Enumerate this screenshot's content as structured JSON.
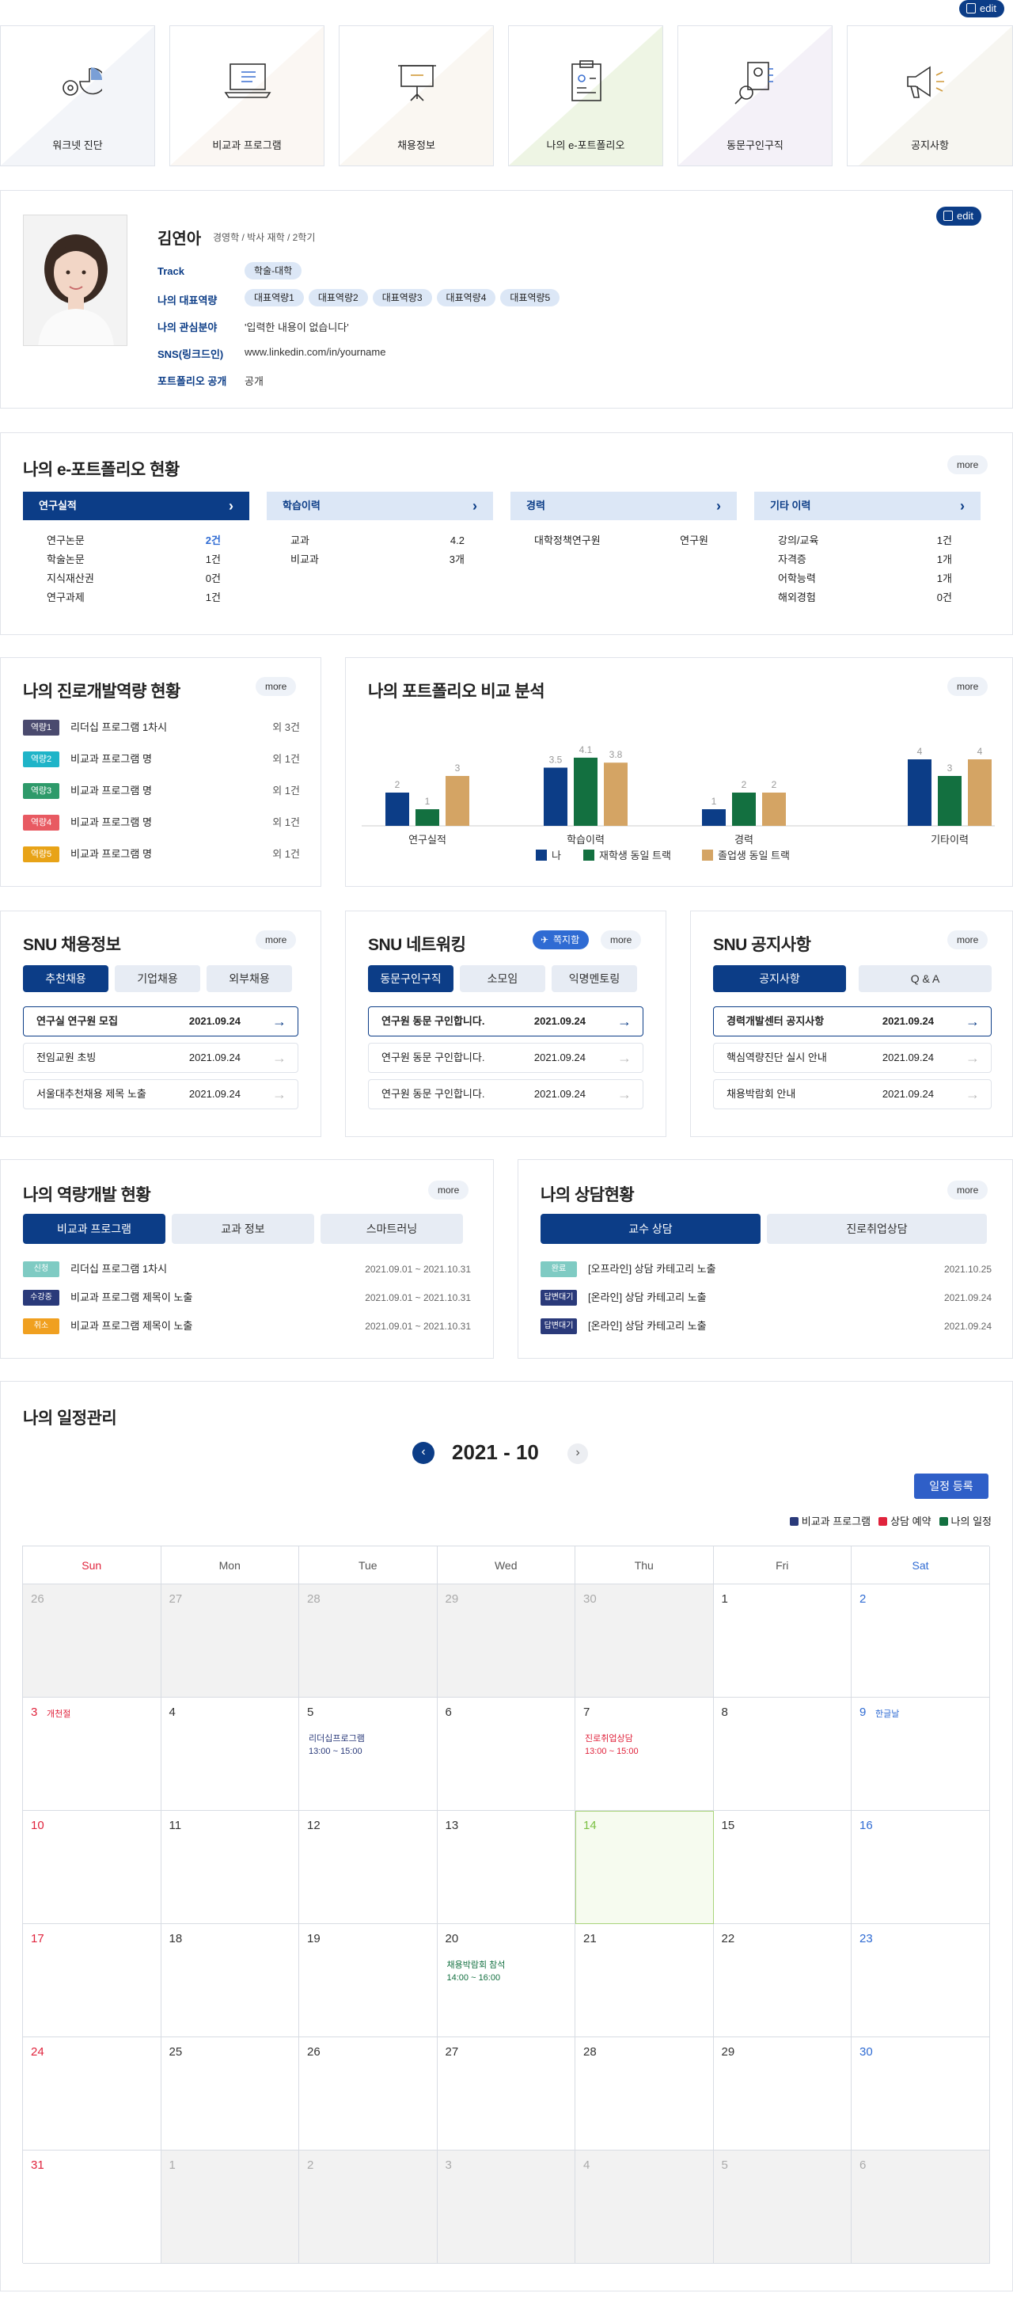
{
  "top_edit_label": "edit",
  "tiles": [
    "워크넷 진단",
    "비교과 프로그램",
    "채용정보",
    "나의 e-포트폴리오",
    "동문구인구직",
    "공지사항"
  ],
  "profile": {
    "edit_label": "edit",
    "name": "김연아",
    "meta": "경영학 / 박사 재학 / 2학기",
    "track_label": "Track",
    "track_value": "학술-대학",
    "rep_label": "나의 대표역량",
    "reps": [
      "대표역량1",
      "대표역량2",
      "대표역량3",
      "대표역량4",
      "대표역량5"
    ],
    "interest_label": "나의 관심분야",
    "interest_value": "'입력한 내용이 없습니다'",
    "sns_label": "SNS(링크드인)",
    "sns_value": "www.linkedin.com/in/yourname",
    "public_label": "포트폴리오 공개",
    "public_value": "공개"
  },
  "eport": {
    "title": "나의 e-포트폴리오 현황",
    "more": "more",
    "cols": [
      {
        "tab": "연구실적",
        "rows": [
          [
            "연구논문",
            "2건"
          ],
          [
            "학술논문",
            "1건"
          ],
          [
            "지식재산권",
            "0건"
          ],
          [
            "연구과제",
            "1건"
          ]
        ]
      },
      {
        "tab": "학습이력",
        "rows": [
          [
            "교과",
            "4.2"
          ],
          [
            "비교과",
            "3개"
          ]
        ]
      },
      {
        "tab": "경력",
        "rows": [
          [
            "대학정책연구원",
            "연구원"
          ]
        ]
      },
      {
        "tab": "기타 이력",
        "rows": [
          [
            "강의/교육",
            "1건"
          ],
          [
            "자격증",
            "1개"
          ],
          [
            "어학능력",
            "1개"
          ],
          [
            "해외경험",
            "0건"
          ]
        ]
      }
    ]
  },
  "career": {
    "title": "나의 진로개발역량 현황",
    "more": "more",
    "rows": [
      {
        "badge": "역량1",
        "color": "#4a4a6e",
        "text": "리더십 프로그램 1차시",
        "count": "외 3건"
      },
      {
        "badge": "역량2",
        "color": "#1fb4c8",
        "text": "비교과 프로그램 명",
        "count": "외 1건"
      },
      {
        "badge": "역량3",
        "color": "#2e9a6a",
        "text": "비교과 프로그램 명",
        "count": "외 1건"
      },
      {
        "badge": "역량4",
        "color": "#e85a62",
        "text": "비교과 프로그램 명",
        "count": "외 1건"
      },
      {
        "badge": "역량5",
        "color": "#e8a317",
        "text": "비교과 프로그램 명",
        "count": "외 1건"
      }
    ]
  },
  "compare": {
    "title": "나의 포트폴리오 비교 분석",
    "more": "more"
  },
  "chart_data": {
    "type": "bar",
    "categories": [
      "연구실적",
      "학습이력",
      "경력",
      "기타이력"
    ],
    "series": [
      {
        "name": "나",
        "color": "#0c3d87",
        "values": [
          2,
          3.5,
          1,
          4
        ]
      },
      {
        "name": "재학생 동일 트랙",
        "color": "#137040",
        "values": [
          1,
          4.1,
          2,
          3
        ]
      },
      {
        "name": "졸업생 동일 트랙",
        "color": "#d4a464",
        "values": [
          3,
          3.8,
          2,
          4
        ]
      }
    ],
    "ylim": [
      0,
      5
    ],
    "legend": "bottom"
  },
  "jobs": {
    "title": "SNU 채용정보",
    "more": "more",
    "tabs": [
      "추천채용",
      "기업채용",
      "외부채용"
    ],
    "rows": [
      [
        "연구실 연구원 모집",
        "2021.09.24"
      ],
      [
        "전임교원 초빙",
        "2021.09.24"
      ],
      [
        "서울대추천채용 제목 노출",
        "2021.09.24"
      ]
    ]
  },
  "network": {
    "title": "SNU 네트워킹",
    "pill": "쪽지함",
    "more": "more",
    "tabs": [
      "동문구인구직",
      "소모임",
      "익명멘토링"
    ],
    "rows": [
      [
        "연구원 동문 구인합니다.",
        "2021.09.24"
      ],
      [
        "연구원 동문 구인합니다.",
        "2021.09.24"
      ],
      [
        "연구원 동문 구인합니다.",
        "2021.09.24"
      ]
    ]
  },
  "notice": {
    "title": "SNU 공지사항",
    "more": "more",
    "tabs": [
      "공지사항",
      "Q & A"
    ],
    "rows": [
      [
        "경력개발센터 공지사항",
        "2021.09.24"
      ],
      [
        "핵심역량진단 실시 안내",
        "2021.09.24"
      ],
      [
        "채용박람회 안내",
        "2021.09.24"
      ]
    ]
  },
  "dev": {
    "title": "나의 역량개발 현황",
    "more": "more",
    "tabs": [
      "비교과 프로그램",
      "교과 정보",
      "스마트러닝"
    ],
    "rows": [
      {
        "badge": "신청",
        "color": "#7fcbc3",
        "text": "리더십 프로그램 1차시",
        "date": "2021.09.01 ~ 2021.10.31"
      },
      {
        "badge": "수강중",
        "color": "#2a3a7a",
        "text": "비교과 프로그램 제목이 노출",
        "date": "2021.09.01 ~ 2021.10.31"
      },
      {
        "badge": "취소",
        "color": "#f0a020",
        "text": "비교과 프로그램 제목이 노출",
        "date": "2021.09.01 ~ 2021.10.31"
      }
    ]
  },
  "counsel": {
    "title": "나의 상담현황",
    "more": "more",
    "tabs": [
      "교수 상담",
      "진로취업상담"
    ],
    "rows": [
      {
        "badge": "완료",
        "color": "#7fcbc3",
        "text": "[오프라인]  상담 카테고리 노출",
        "date": "2021.10.25"
      },
      {
        "badge": "답변대기",
        "color": "#2a3a7a",
        "text": "[온라인]  상담 카테고리 노출",
        "date": "2021.09.24"
      },
      {
        "badge": "답변대기",
        "color": "#2a3a7a",
        "text": "[온라인]  상담 카테고리 노출",
        "date": "2021.09.24"
      }
    ]
  },
  "schedule": {
    "title": "나의 일정관리",
    "month": "2021 - 10",
    "register": "일정 등록",
    "legend": [
      {
        "label": "비교과 프로그램",
        "color": "#2a3a7a"
      },
      {
        "label": "상담 예약",
        "color": "#e0233c"
      },
      {
        "label": "나의 일정",
        "color": "#137040"
      }
    ],
    "weekdays": [
      "Sun",
      "Mon",
      "Tue",
      "Wed",
      "Thu",
      "Fri",
      "Sat"
    ],
    "cells": [
      {
        "d": "26",
        "dim": true
      },
      {
        "d": "27",
        "dim": true
      },
      {
        "d": "28",
        "dim": true
      },
      {
        "d": "29",
        "dim": true
      },
      {
        "d": "30",
        "dim": true
      },
      {
        "d": "1"
      },
      {
        "d": "2"
      },
      {
        "d": "3",
        "note": "개천절"
      },
      {
        "d": "4"
      },
      {
        "d": "5",
        "ev": "리더십프로그램",
        "evt": "13:00 ~ 15:00",
        "evc": "#2a3a7a"
      },
      {
        "d": "6"
      },
      {
        "d": "7",
        "ev": "진로취업상담",
        "evt": "13:00 ~ 15:00",
        "evc": "#e0233c"
      },
      {
        "d": "8"
      },
      {
        "d": "9",
        "note": "한글날"
      },
      {
        "d": "10"
      },
      {
        "d": "11"
      },
      {
        "d": "12"
      },
      {
        "d": "13"
      },
      {
        "d": "14",
        "today": true
      },
      {
        "d": "15"
      },
      {
        "d": "16"
      },
      {
        "d": "17"
      },
      {
        "d": "18"
      },
      {
        "d": "19"
      },
      {
        "d": "20",
        "ev": "채용박람회 참석",
        "evt": "14:00 ~ 16:00",
        "evc": "#137040"
      },
      {
        "d": "21"
      },
      {
        "d": "22"
      },
      {
        "d": "23"
      },
      {
        "d": "24"
      },
      {
        "d": "25"
      },
      {
        "d": "26"
      },
      {
        "d": "27"
      },
      {
        "d": "28"
      },
      {
        "d": "29"
      },
      {
        "d": "30"
      },
      {
        "d": "31"
      },
      {
        "d": "1",
        "dim": true
      },
      {
        "d": "2",
        "dim": true
      },
      {
        "d": "3",
        "dim": true
      },
      {
        "d": "4",
        "dim": true
      },
      {
        "d": "5",
        "dim": true
      },
      {
        "d": "6",
        "dim": true
      }
    ]
  }
}
